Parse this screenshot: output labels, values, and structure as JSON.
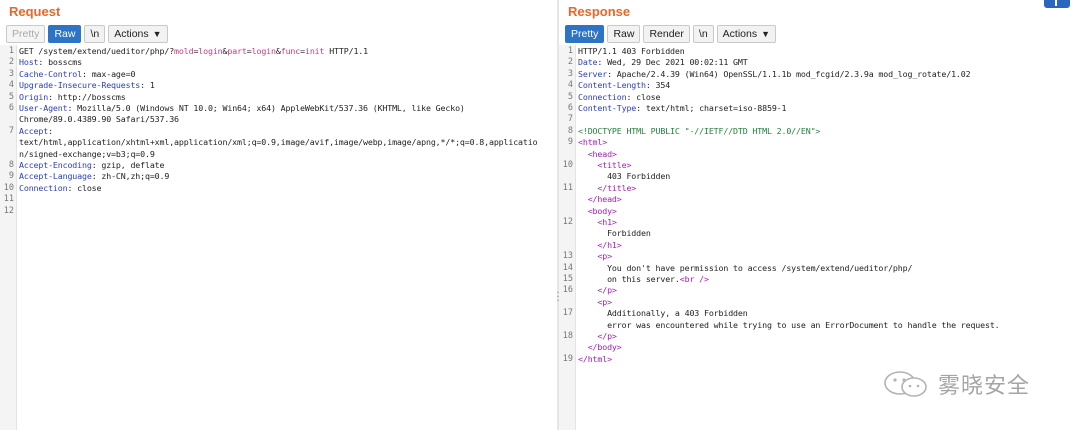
{
  "request": {
    "title": "Request",
    "tabs": [
      "Pretty",
      "Raw",
      "\\n"
    ],
    "actions_label": "Actions",
    "line_numbers": [
      "1",
      "2",
      "3",
      "4",
      "5",
      "6",
      "",
      "7",
      "",
      "",
      "8",
      "9",
      "10",
      "11",
      "12"
    ],
    "lines": [
      [
        [
          "GET /system/extend/ueditor/php/?",
          "hv"
        ],
        [
          "mold",
          "pk"
        ],
        [
          "=",
          "hv"
        ],
        [
          "login",
          "pk"
        ],
        [
          "&",
          "hv"
        ],
        [
          "part",
          "pk"
        ],
        [
          "=",
          "hv"
        ],
        [
          "login",
          "pk"
        ],
        [
          "&",
          "hv"
        ],
        [
          "func",
          "pk"
        ],
        [
          "=",
          "hv"
        ],
        [
          "init",
          "pk"
        ],
        [
          " HTTP/1.1",
          "hv"
        ]
      ],
      [
        [
          "Host",
          "hk"
        ],
        [
          ": bosscms",
          "hv"
        ]
      ],
      [
        [
          "Cache-Control",
          "hk"
        ],
        [
          ": max-age=0",
          "hv"
        ]
      ],
      [
        [
          "Upgrade-Insecure-Requests",
          "hk"
        ],
        [
          ": 1",
          "hv"
        ]
      ],
      [
        [
          "Origin",
          "hk"
        ],
        [
          ": http://bosscms",
          "hv"
        ]
      ],
      [
        [
          "User-Agent",
          "hk"
        ],
        [
          ": Mozilla/5.0 (Windows NT 10.0; Win64; x64) AppleWebKit/537.36 (KHTML, like Gecko)",
          "hv"
        ]
      ],
      [
        [
          "Chrome/89.0.4389.90 Safari/537.36",
          "hv"
        ]
      ],
      [
        [
          "Accept",
          "hk"
        ],
        [
          ":",
          "hv"
        ]
      ],
      [
        [
          "text/html,application/xhtml+xml,application/xml;q=0.9,image/avif,image/webp,image/apng,*/*;q=0.8,applicatio",
          "hv"
        ]
      ],
      [
        [
          "n/signed-exchange;v=b3;q=0.9",
          "hv"
        ]
      ],
      [
        [
          "Accept-Encoding",
          "hk"
        ],
        [
          ": gzip, deflate",
          "hv"
        ]
      ],
      [
        [
          "Accept-Language",
          "hk"
        ],
        [
          ": zh-CN,zh;q=0.9",
          "hv"
        ]
      ],
      [
        [
          "Connection",
          "hk"
        ],
        [
          ": close",
          "hv"
        ]
      ],
      [
        [
          "",
          "hv"
        ]
      ],
      [
        [
          "",
          "hv"
        ]
      ]
    ]
  },
  "response": {
    "title": "Response",
    "tabs": [
      "Pretty",
      "Raw",
      "Render",
      "\\n"
    ],
    "actions_label": "Actions",
    "line_numbers": [
      "1",
      "2",
      "3",
      "4",
      "5",
      "6",
      "7",
      "8",
      "9",
      "",
      "10",
      "",
      "11",
      "",
      "",
      "12",
      "",
      "",
      "13",
      "14",
      "15",
      "16",
      "",
      "17",
      "",
      "18",
      "",
      "19"
    ],
    "lines": [
      [
        [
          "HTTP/1.1 403 Forbidden",
          "hv"
        ]
      ],
      [
        [
          "Date",
          "hk"
        ],
        [
          ": Wed, 29 Dec 2021 00:02:11 GMT",
          "hv"
        ]
      ],
      [
        [
          "Server",
          "hk"
        ],
        [
          ": Apache/2.4.39 (Win64) OpenSSL/1.1.1b mod_fcgid/2.3.9a mod_log_rotate/1.02",
          "hv"
        ]
      ],
      [
        [
          "Content-Length",
          "hk"
        ],
        [
          ": 354",
          "hv"
        ]
      ],
      [
        [
          "Connection",
          "hk"
        ],
        [
          ": close",
          "hv"
        ]
      ],
      [
        [
          "Content-Type",
          "hk"
        ],
        [
          ": text/html; charset=iso-8859-1",
          "hv"
        ]
      ],
      [
        [
          "",
          "hv"
        ]
      ],
      [
        [
          "<!DOCTYPE HTML PUBLIC \"-//IETF//DTD HTML 2.0//EN\">",
          "dt"
        ]
      ],
      [
        [
          "<html>",
          "tag"
        ]
      ],
      [
        [
          "  <head>",
          "tag"
        ]
      ],
      [
        [
          "    <title>",
          "tag"
        ]
      ],
      [
        [
          "      403 Forbidden",
          "txt"
        ]
      ],
      [
        [
          "    </title>",
          "tag"
        ]
      ],
      [
        [
          "  </head>",
          "tag"
        ]
      ],
      [
        [
          "  <body>",
          "tag"
        ]
      ],
      [
        [
          "    <h1>",
          "tag"
        ]
      ],
      [
        [
          "      Forbidden",
          "txt"
        ]
      ],
      [
        [
          "    </h1>",
          "tag"
        ]
      ],
      [
        [
          "    <p>",
          "tag"
        ]
      ],
      [
        [
          "      You don't have permission to access /system/extend/ueditor/php/",
          "txt"
        ]
      ],
      [
        [
          "      on this server.",
          "txt"
        ],
        [
          "<br />",
          "tag"
        ]
      ],
      [
        [
          "    </p>",
          "tag"
        ]
      ],
      [
        [
          "    <p>",
          "tag"
        ]
      ],
      [
        [
          "      Additionally, a 403 Forbidden",
          "txt"
        ]
      ],
      [
        [
          "      error was encountered while trying to use an ErrorDocument to handle the request.",
          "txt"
        ]
      ],
      [
        [
          "    </p>",
          "tag"
        ]
      ],
      [
        [
          "  </body>",
          "tag"
        ]
      ],
      [
        [
          "</html>",
          "tag"
        ]
      ],
      [
        [
          "",
          "hv"
        ]
      ]
    ]
  },
  "watermark": {
    "text": "雾晓安全",
    "icon": "wechat-icon"
  },
  "colors": {
    "title": "#e8672a",
    "active_tab": "#2d74c4",
    "header_key": "#2c3fb5",
    "param": "#c53a8a",
    "tag": "#a020b0",
    "doctype": "#23803d"
  }
}
